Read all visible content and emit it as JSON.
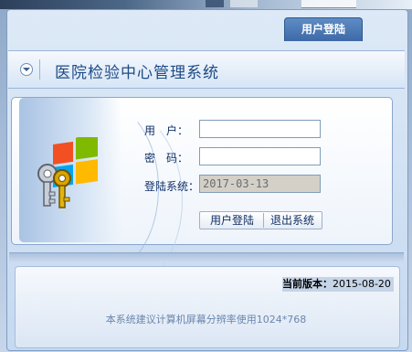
{
  "tab": {
    "label": "用户登陆"
  },
  "header": {
    "title": "医院检验中心管理系统"
  },
  "form": {
    "username_label": "用　户：",
    "username_value": "",
    "password_label": "密　码：",
    "password_value": "",
    "login_date_label": "登陆系统：",
    "login_date_value": "2017-03-13"
  },
  "buttons": {
    "login": "用户登陆",
    "exit": "退出系统"
  },
  "footer": {
    "version_label": "当前版本：",
    "version_value": "2015-08-20",
    "resolution_note": "本系统建议计算机屏幕分辨率使用1024*768"
  },
  "colors": {
    "accent": "#3d6aa7",
    "title": "#1d4a86",
    "label": "#0f2f66"
  },
  "icons": [
    "collapse-icon",
    "windows-keys-icon"
  ]
}
